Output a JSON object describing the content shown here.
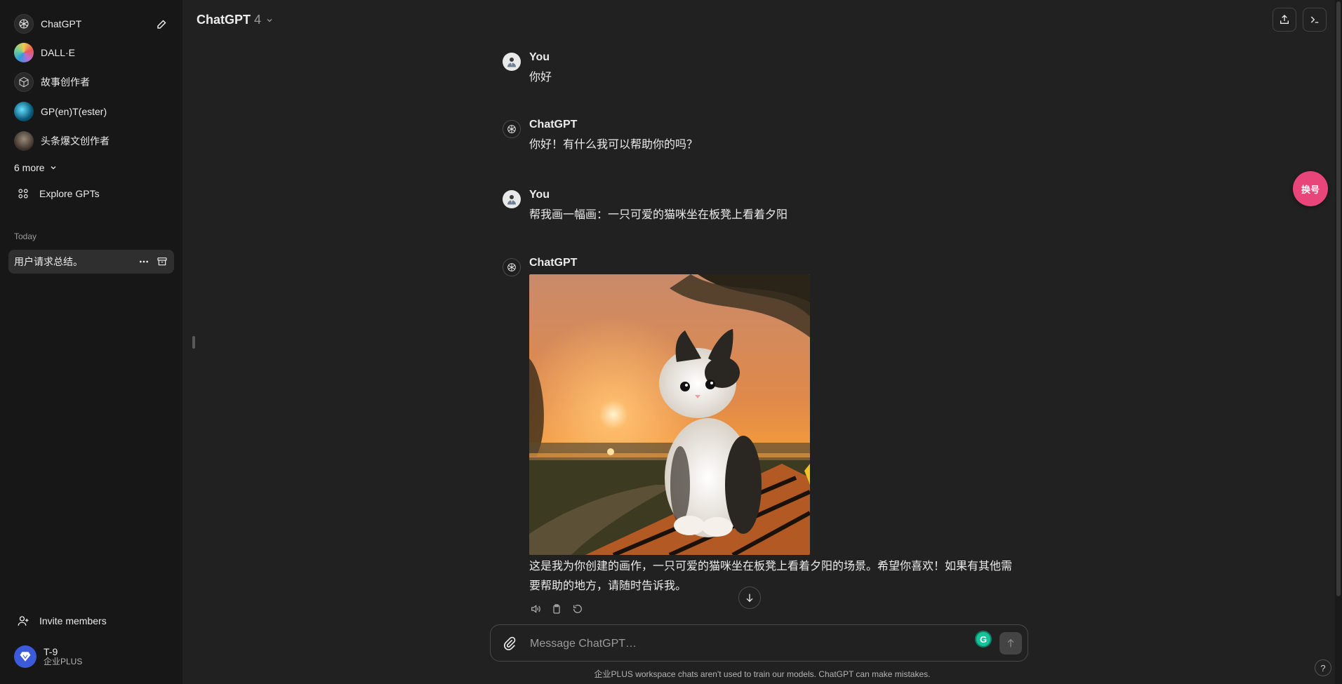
{
  "sidebar": {
    "gpts": [
      {
        "label": "ChatGPT",
        "icon": "chatgpt-logo-icon"
      },
      {
        "label": "DALL·E",
        "icon": "dalle-avatar"
      },
      {
        "label": "故事创作者",
        "icon": "cube-icon"
      },
      {
        "label": "GP(en)T(ester)",
        "icon": "globe-avatar"
      },
      {
        "label": "头条爆文创作者",
        "icon": "photo-avatar"
      }
    ],
    "more_label": "6 more",
    "explore_label": "Explore GPTs",
    "section_today": "Today",
    "chats": [
      {
        "label": "用户请求总结。"
      }
    ],
    "invite_label": "Invite members",
    "user": {
      "name": "T-9",
      "plan": "企业PLUS"
    }
  },
  "header": {
    "model_name": "ChatGPT",
    "model_version": "4"
  },
  "messages": [
    {
      "author": "You",
      "text": "你好",
      "role": "user"
    },
    {
      "author": "ChatGPT",
      "text": "你好！有什么我可以帮助你的吗？",
      "role": "assistant"
    },
    {
      "author": "You",
      "text": "帮我画一幅画：一只可爱的猫咪坐在板凳上看着夕阳",
      "role": "user"
    },
    {
      "author": "ChatGPT",
      "text": "这是我为你创建的画作，一只可爱的猫咪坐在板凳上看着夕阳的场景。希望你喜欢！如果有其他需要帮助的地方，请随时告诉我。",
      "role": "assistant"
    }
  ],
  "composer": {
    "placeholder": "Message ChatGPT…"
  },
  "footer": {
    "brand": "企业",
    "note": "PLUS workspace chats aren't used to train our models. ChatGPT can make mistakes."
  },
  "floating_button_label": "换号",
  "help_label": "?",
  "colors": {
    "accent_pink": "#e8457a",
    "grammarly": "#15c39a",
    "bg": "#212121",
    "sidebar": "#171717"
  }
}
